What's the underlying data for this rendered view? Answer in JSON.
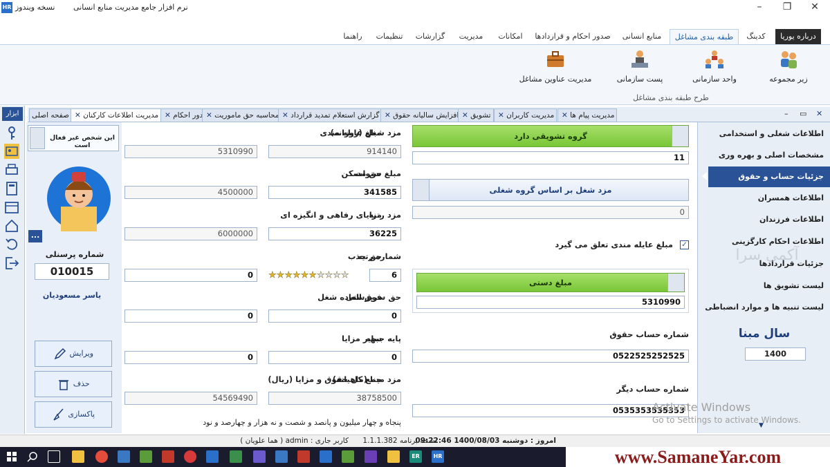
{
  "window": {
    "app_badge": "HR",
    "edition": "نسخه ویندوز",
    "title": "نرم افزار جامع مدیریت منابع انسانی",
    "minimize": "–",
    "restore": "❐",
    "close": "✕"
  },
  "ribbon": {
    "tabs": [
      {
        "label": "درباره یوریا"
      },
      {
        "label": "کدینگ"
      },
      {
        "label": "طبقه بندی مشاغل"
      },
      {
        "label": "منابع انسانی"
      },
      {
        "label": "صدور احکام و قراردادها"
      },
      {
        "label": "امکانات"
      },
      {
        "label": "مدیریت"
      },
      {
        "label": "گزارشات"
      },
      {
        "label": "تنظیمات"
      },
      {
        "label": "راهنما"
      }
    ],
    "items": [
      {
        "label": "زیر مجموعه",
        "icon": "people-group-icon"
      },
      {
        "label": "واحد سازمانی",
        "icon": "org-unit-icon"
      },
      {
        "label": "پست سازمانی",
        "icon": "org-post-icon"
      },
      {
        "label": "مدیریت عناوین مشاغل",
        "icon": "briefcase-icon"
      }
    ],
    "group_label": "طرح طبقه بندی مشاغل"
  },
  "toolstrip": {
    "title": "ابزار",
    "tools": [
      "key-icon",
      "id-card-icon",
      "printer-icon",
      "calculator-icon",
      "calendar-icon",
      "home-icon",
      "undo-icon",
      "exit-icon"
    ]
  },
  "doc_tabs": [
    {
      "label": "صفحه اصلی",
      "active": false,
      "closable": false
    },
    {
      "label": "مدیریت اطلاعات کارکنان",
      "active": true,
      "closable": true
    },
    {
      "label": "صدور احکام",
      "active": false,
      "closable": true
    },
    {
      "label": "محاسبه حق ماموریت",
      "active": false,
      "closable": true
    },
    {
      "label": "گزارش استعلام تمدید قرارداد",
      "active": false,
      "closable": true
    },
    {
      "label": "افزایش سالیانه حقوق",
      "active": false,
      "closable": true
    },
    {
      "label": "تشویق",
      "active": false,
      "closable": true
    },
    {
      "label": "مدیریت کاربران",
      "active": false,
      "closable": true
    },
    {
      "label": "مدیریت پیام ها",
      "active": false,
      "closable": true
    }
  ],
  "doc_controls": {
    "close": "✕",
    "restore": "▭",
    "minimize": "–"
  },
  "profile": {
    "inactive_label": "این شخص غیر فعال است",
    "more": "...",
    "personnel_label": "شماره پرسنلی",
    "personnel_no": "010015",
    "name": "یاسر مسعودیان",
    "edit": "ویرایش",
    "delete": "حذف",
    "clear": "پاکسازی"
  },
  "form": {
    "col1": [
      {
        "label": "مبلغ عایله مندی",
        "value": "5310990"
      },
      {
        "label": "حق مسکن",
        "value": "4500000"
      },
      {
        "label": "مزایای رفاهی و انگیزه ای",
        "value": "6000000"
      },
      {
        "label": "حق جذب",
        "value": "0"
      },
      {
        "label": "فوق العاده شغل",
        "value": "0"
      },
      {
        "label": "سایر مزایا",
        "value": "0"
      },
      {
        "label": "جمع کل حقوق و مزایا (ریال)",
        "value": "54569490"
      }
    ],
    "col2": [
      {
        "label": "مزد شغل (روزانه)",
        "value": "914140"
      },
      {
        "label": "مبلغ سنوات",
        "value": "341585"
      },
      {
        "label": "مزد رتبه",
        "value": "36225"
      },
      {
        "label": "شماره رتبه",
        "value": "6"
      },
      {
        "label": "حق سرپرستی",
        "value": "0"
      },
      {
        "label": "پایه جبهه",
        "value": "0"
      },
      {
        "label": "مزد مبنا (ماهیانه)",
        "value": "38758500"
      }
    ],
    "rating": {
      "value": 6,
      "max": 10
    },
    "amount_in_words": "پنجاه و چهار میلیون و پانصد و شصت و نه هزار و چهارصد و نود"
  },
  "side": {
    "incentive_bar": "گروه تشویقی دارد",
    "incentive_value": "11",
    "wage_bar": "مزد شغل بر اساس گروه شغلی",
    "wage_value": "0",
    "family_check_label": "مبلغ عایله مندی تعلق می گیرد",
    "family_checked": true,
    "manual_bar": "مبلغ دستی",
    "manual_value": "5310990",
    "salary_account_label": "شماره حساب حقوق",
    "salary_account": "0522525252525",
    "other_account_label": "شماره حساب دیگر",
    "other_account": "0535353535353"
  },
  "rightnav": {
    "items": [
      {
        "label": "اطلاعات شغلی و استخدامی",
        "active": false
      },
      {
        "label": "مشخصات اصلی و بهره وری",
        "active": false
      },
      {
        "label": "جزئیات حساب و حقوق",
        "active": true
      },
      {
        "label": "اطلاعات همسران",
        "active": false
      },
      {
        "label": "اطلاعات فرزندان",
        "active": false
      },
      {
        "label": "اطلاعات احکام کارگزینی",
        "active": false
      },
      {
        "label": "جزئیات قراردادها",
        "active": false
      },
      {
        "label": "لیست تشویق ها",
        "active": false
      },
      {
        "label": "لیست تنبیه ها و موارد انضباطی",
        "active": false
      }
    ],
    "year_label": "سال مبنا",
    "year_value": "1400",
    "watermark": "آکمی سرا",
    "activate_title": "Activate Windows",
    "activate_sub": "Go to Settings to activate Windows.",
    "scroll_down": "▼"
  },
  "status": {
    "today": "امروز : دوشنبه  1400/08/03   09:22:46",
    "version": "نسخه برنامه   1.1.1.382",
    "user": "کاربر جاری :  admin   ( هما علویان )"
  },
  "taskbar": {
    "brand": "www.SamaneYar.com",
    "icons": [
      "windows-start-icon",
      "search-icon",
      "task-view-icon",
      "file-explorer-icon",
      "chrome-icon",
      "app-icon",
      "app-icon",
      "app-icon",
      "app-icon",
      "app-icon",
      "app-icon",
      "security-icon",
      "app-icon",
      "app-icon",
      "app-icon",
      "visual-studio-icon",
      "notes-icon",
      "er-app-icon",
      "hr-app-icon"
    ]
  },
  "colors": {
    "accent": "#2a5296",
    "green": "#79c636",
    "brand": "#8a1c1c"
  }
}
